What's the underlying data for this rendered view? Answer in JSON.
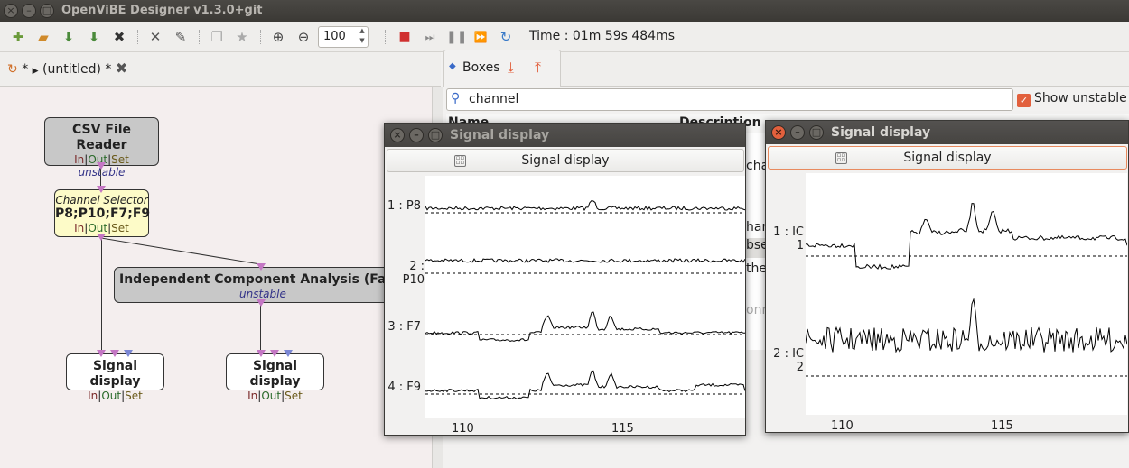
{
  "app": {
    "title": "OpenViBE Designer v1.3.0+git",
    "zoom": "100",
    "time": "Time : 01m 59s 484ms"
  },
  "left_pane": {
    "tab": {
      "label": "(untitled) *",
      "prefix": "*"
    },
    "boxes": [
      {
        "title": "CSV File Reader",
        "io": [
          "In",
          "Out",
          "Set"
        ],
        "badge": "unstable"
      },
      {
        "title_top": "Channel Selector",
        "title": "P8;P10;F7;F9",
        "io": [
          "In",
          "Out",
          "Set"
        ]
      },
      {
        "title": "Independent Component Analysis (FastIC",
        "badge": "unstable"
      },
      {
        "title": "Signal display",
        "io": [
          "In",
          "Out",
          "Set"
        ]
      },
      {
        "title": "Signal display",
        "io": [
          "In",
          "Out",
          "Set"
        ]
      }
    ]
  },
  "right_pane": {
    "tab": {
      "label": "Boxes"
    },
    "search": {
      "value": "channel"
    },
    "show_unstable": "Show unstable",
    "list_headers": [
      "Name",
      "Description"
    ],
    "fragments": [
      "cha",
      "har",
      "bse",
      "the",
      "onn"
    ]
  },
  "signal_display_1": {
    "window_title": "Signal display",
    "header_button": "Signal display",
    "channels": [
      "1 : P8",
      "2 : P10",
      "3 : F7",
      "4 : F9"
    ],
    "x_ticks": [
      "110",
      "115"
    ]
  },
  "signal_display_2": {
    "window_title": "Signal display",
    "header_button": "Signal display",
    "channels": [
      "1 : IC 1",
      "2 : IC 2"
    ],
    "x_ticks": [
      "110",
      "115"
    ]
  },
  "colors": {
    "accent": "#e2603d",
    "titlebar": "#3b3935",
    "channel_selector_bg": "#fdfbc8",
    "box_gray": "#c8c8c8",
    "pin": "#c477c4"
  }
}
